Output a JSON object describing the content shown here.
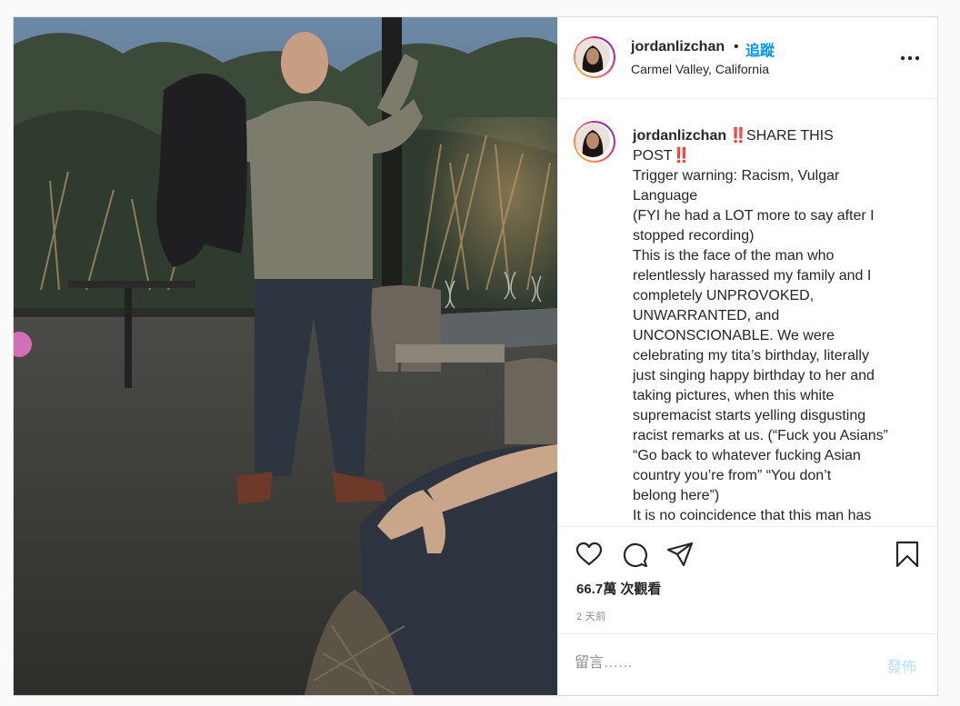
{
  "post": {
    "username": "jordanlizchan",
    "separator": "•",
    "follow_label": "追蹤",
    "location": "Carmel Valley, California",
    "more_options_icon": "more-horizontal-icon"
  },
  "caption": {
    "username": "jordanlizchan",
    "title_part1": "SHARE THIS",
    "title_part2": "POST",
    "exclamation_emoji": "‼️",
    "lines": [
      "Trigger warning: Racism, Vulgar",
      "Language",
      "(FYI he had a LOT more to say after I",
      "stopped recording)",
      "This is the face of the man who",
      "relentlessly harassed my family and I",
      "completely UNPROVOKED,",
      "UNWARRANTED, and",
      "UNCONSCIONABLE. We were",
      "celebrating my tita’s birthday, literally",
      "just singing happy birthday to her and",
      "taking pictures, when this white",
      "supremacist starts yelling disgusting",
      "racist remarks at us. (“Fuck you Asians”",
      "“Go back to whatever fucking Asian",
      "country you’re from” “You don’t",
      "belong here”)",
      "It is no coincidence that this man has"
    ]
  },
  "actions": {
    "like_icon": "heart-icon",
    "comment_icon": "comment-bubble-icon",
    "share_icon": "paper-plane-icon",
    "save_icon": "bookmark-icon",
    "views": "66.7萬 次觀看",
    "timestamp": "2 天前"
  },
  "comment": {
    "placeholder": "留言……",
    "post_label": "發佈"
  },
  "colors": {
    "link_blue": "#0095f6",
    "post_disabled": "#b2dffc",
    "text": "#262626",
    "muted": "#8e8e8e",
    "border": "#dbdbdb"
  }
}
